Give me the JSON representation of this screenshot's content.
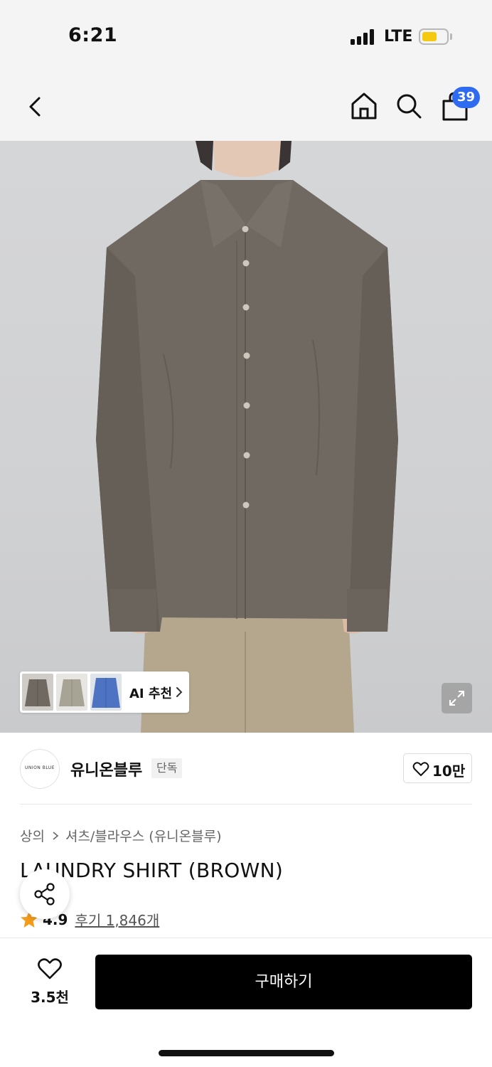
{
  "status_bar": {
    "time": "6:21",
    "network": "LTE",
    "battery_level": 0.6,
    "battery_color": "#f5c90f"
  },
  "nav": {
    "back_icon": "chevron-left",
    "home_icon": "home",
    "search_icon": "search",
    "cart_icon": "shopping-bag",
    "cart_badge": "39",
    "badge_color": "#2f6bf0"
  },
  "gallery": {
    "ai_recommend_label": "AI 추천",
    "expand_icon": "expand"
  },
  "brand": {
    "logo_text": "UNION BLUE",
    "name": "유니온블루",
    "badge": "단독",
    "like_count": "10만"
  },
  "breadcrumb": {
    "items": [
      "상의",
      "셔츠/블라우스 (유니온블루)"
    ]
  },
  "product": {
    "title": "LAUNDRY SHIRT (BROWN)",
    "rating": "4.9",
    "review_link": "후기 1,846개",
    "star_color": "#f39c1a"
  },
  "bottom_bar": {
    "wish_count": "3.5천",
    "buy_label": "구매하기"
  }
}
